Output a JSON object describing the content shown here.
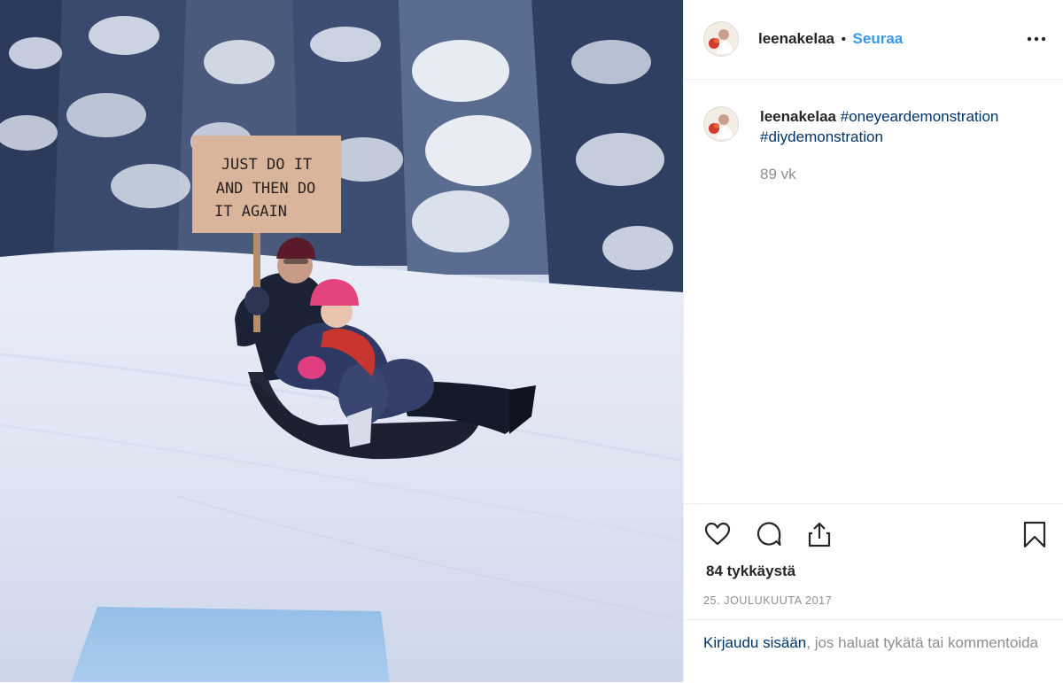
{
  "post": {
    "username": "leenakelaa",
    "separator": "•",
    "follow_label": "Seuraa",
    "more_icon": "more-options-icon",
    "caption": {
      "username": "leenakelaa",
      "hashtag1": "#oneyeardemonstration",
      "hashtag2": "#diydemonstration"
    },
    "time_ago": "89 vk",
    "likes": "84 tykkäystä",
    "date": "25. JOULUKUUTA 2017",
    "login_link": "Kirjaudu sisään",
    "login_text": ", jos haluat tykätä tai kommentoida",
    "icons": [
      "heart-icon",
      "comment-icon",
      "share-icon",
      "bookmark-icon"
    ]
  },
  "photo": {
    "sign_line1": "JUST DO IT",
    "sign_line2": "AND THEN DO",
    "sign_line3": "IT AGAIN"
  },
  "colors": {
    "accent": "#3897f0",
    "link": "#003569",
    "muted": "#8e8e8e",
    "text": "#262626",
    "border": "#efefef"
  }
}
